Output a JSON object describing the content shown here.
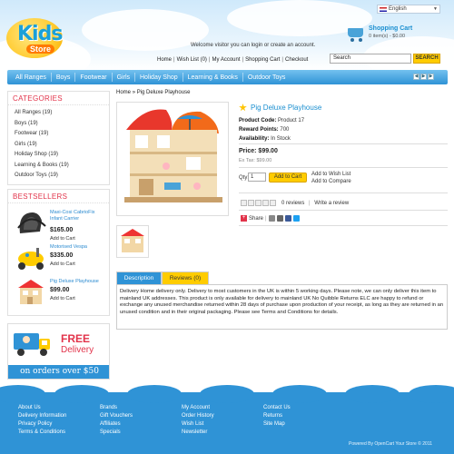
{
  "language": {
    "selected": "English"
  },
  "logo": {
    "line1": "Kids",
    "line2": "Store"
  },
  "cart": {
    "title": "Shopping Cart",
    "summary": "0 item(s) - $0.00"
  },
  "welcome": "Welcome visitor you can login or create an account.",
  "toplinks": [
    "Home",
    "Wish List (0)",
    "My Account",
    "Shopping Cart",
    "Checkout"
  ],
  "search": {
    "value": "Search",
    "button": "SEARCH"
  },
  "nav": [
    "All Ranges",
    "Boys",
    "Footwear",
    "Girls",
    "Holiday Shop",
    "Learning & Books",
    "Outdoor Toys"
  ],
  "breadcrumb": [
    "Home",
    "Pig Deluxe Playhouse"
  ],
  "categories": {
    "title": "CATEGORIES",
    "items": [
      "All Ranges (19)",
      "Boys (19)",
      "Footwear (19)",
      "Girls (19)",
      "Holiday Shop (19)",
      "Learning & Books (19)",
      "Outdoor Toys (19)"
    ]
  },
  "bestsellers": {
    "title": "BESTSELLERS",
    "items": [
      {
        "name": "Maxi-Cosi CabrioFix Infant Carrier",
        "price": "$165.00",
        "add": "Add to Cart"
      },
      {
        "name": "Motorised Vespa",
        "price": "$335.00",
        "add": "Add to Cart"
      },
      {
        "name": "Pig Deluxe Playhouse",
        "price": "$99.00",
        "add": "Add to Cart"
      }
    ]
  },
  "free_delivery": {
    "line1": "FREE",
    "line2": "Delivery",
    "banner": "on orders over $50"
  },
  "product": {
    "title": "Pig Deluxe Playhouse",
    "code_label": "Product Code:",
    "code": "Product 17",
    "points_label": "Reward Points:",
    "points": "700",
    "avail_label": "Availability:",
    "avail": "In Stock",
    "price_label": "Price:",
    "price": "$99.00",
    "extax": "Ex Tax: $99.00",
    "qty_label": "Qty:",
    "qty": "1",
    "add_to_cart": "Add to Cart",
    "or": "- OR -",
    "wishlist": "Add to Wish List",
    "compare": "Add to Compare",
    "reviews": "0 reviews",
    "write_review": "Write a review",
    "share": "Share"
  },
  "tabs": {
    "description": "Description",
    "reviews": "Reviews (0)"
  },
  "description": "Delivery Home delivery only. Delivery to most customers in the UK is within 5 working days. Please note, we can only deliver this item to mainland UK addresses. This product is only available for delivery to mainland UK No Quibble Returns ELC are happy to refund or exchange any unused merchandise returned within 28 days of purchase upon production of your receipt, as long as they are returned in an unused condition and in their original packaging. Please see Terms and Conditions for details.",
  "footer": {
    "col1": [
      "About Us",
      "Delivery Information",
      "Privacy Policy",
      "Terms & Conditions"
    ],
    "col2": [
      "Brands",
      "Gift Vouchers",
      "Affiliates",
      "Specials"
    ],
    "col3": [
      "My Account",
      "Order History",
      "Wish List",
      "Newsletter"
    ],
    "col4": [
      "Contact Us",
      "Returns",
      "Site Map"
    ],
    "powered": "Powered By OpenCart Your Store © 2011"
  },
  "colors": {
    "accent": "#2f93d6",
    "link": "#1b8fd0",
    "heading": "#e2334a",
    "button": "#ffcc00"
  }
}
